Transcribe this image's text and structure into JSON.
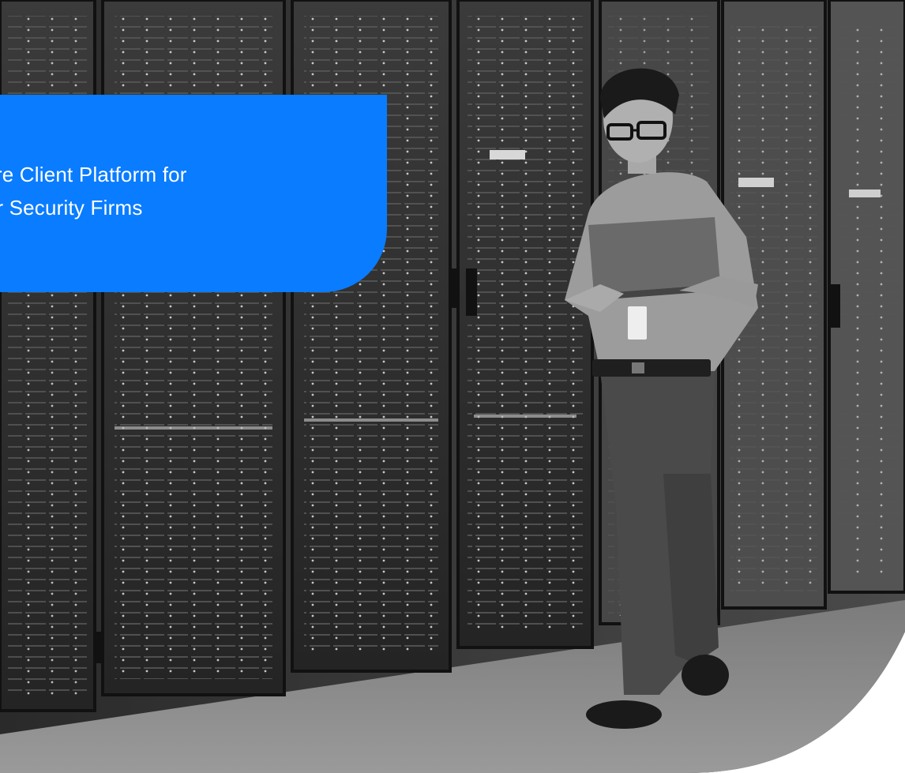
{
  "hero": {
    "caption_line_1": "cure Client Platform for",
    "caption_line_2": "ber Security Firms",
    "card_color": "#0A7CFF",
    "photo_style": "grayscale",
    "photo_subject": "person-walking-with-laptop-in-server-room"
  }
}
